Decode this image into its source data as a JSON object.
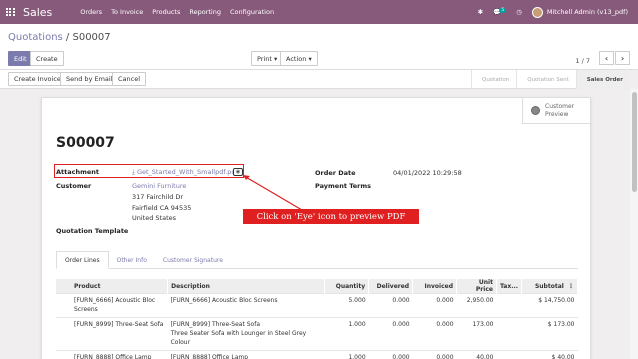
{
  "navbar": {
    "brand": "Sales",
    "menu": [
      "Orders",
      "To Invoice",
      "Products",
      "Reporting",
      "Configuration"
    ],
    "message_count": "5",
    "user": "Mitchell Admin (v13_pdf)"
  },
  "breadcrumb": {
    "parent": "Quotations",
    "separator": " / ",
    "current": "S00007"
  },
  "toolbar": {
    "edit": "Edit",
    "create": "Create",
    "print": "Print",
    "action": "Action",
    "pager": "1 / 7"
  },
  "status_buttons": {
    "create_invoice": "Create Invoice",
    "send_email": "Send by Email",
    "cancel": "Cancel"
  },
  "stages": [
    "Quotation",
    "Quotation Sent",
    "Sales Order"
  ],
  "sheet": {
    "customer_preview": [
      "Customer",
      "Preview"
    ],
    "order_name": "S00007",
    "attachment_label": "Attachment",
    "attachment_file": "Get_Started_With_Smallpdf.pdf",
    "customer_label": "Customer",
    "customer_name": "Gemini Furniture",
    "address": [
      "317 Fairchild Dr",
      "Fairfield CA 94535",
      "United States"
    ],
    "order_date_label": "Order Date",
    "order_date": "04/01/2022 10:29:58",
    "payment_terms_label": "Payment Terms",
    "template_label": "Quotation Template",
    "callout": "Click on 'Eye' icon to preview PDF"
  },
  "tabs": [
    "Order Lines",
    "Other Info",
    "Customer Signature"
  ],
  "table": {
    "headers": [
      "Product",
      "Description",
      "Quantity",
      "Delivered",
      "Invoiced",
      "Unit Price",
      "Tax...",
      "Subtotal"
    ],
    "rows": [
      {
        "product": "[FURN_6666] Acoustic Bloc Screens",
        "description": [
          "[FURN_6666] Acoustic Bloc Screens"
        ],
        "qty": "5.000",
        "delivered": "0.000",
        "invoiced": "0.000",
        "price": "2,950.00",
        "tax": "",
        "subtotal": "$ 14,750.00"
      },
      {
        "product": "[FURN_8999] Three-Seat Sofa",
        "description": [
          "[FURN_8999] Three-Seat Sofa",
          "Three Seater Sofa with Lounger in Steel Grey",
          "Colour"
        ],
        "qty": "1.000",
        "delivered": "0.000",
        "invoiced": "0.000",
        "price": "173.00",
        "tax": "",
        "subtotal": "$ 173.00"
      },
      {
        "product": "[FURN_8888] Office Lamp",
        "description": [
          "[FURN_8888] Office Lamp"
        ],
        "qty": "1.000",
        "delivered": "0.000",
        "invoiced": "0.000",
        "price": "40.00",
        "tax": "",
        "subtotal": "$ 40.00"
      }
    ]
  },
  "colors": {
    "navbar": "#875a7b",
    "primary": "#7c7bad",
    "callout": "#e02020"
  },
  "icons": [
    "apps-grid-icon",
    "bug-icon",
    "chat-icon",
    "clock-icon",
    "eye-icon",
    "globe-icon",
    "chevron-left-icon",
    "chevron-right-icon",
    "download-icon"
  ]
}
